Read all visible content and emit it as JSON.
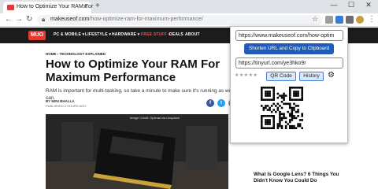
{
  "browser": {
    "tab_title": "How to Optimize Your RAM For",
    "new_tab": "+",
    "controls": {
      "minimize": "—",
      "maximize": "☐",
      "close": "✕"
    },
    "url_host": "makeuseof.com",
    "url_path": "/how-optimize-ram-for-maximum-performance/"
  },
  "site": {
    "logo": "MUO",
    "nav": [
      "PC & MOBILE ▾",
      "LIFESTYLE ▾",
      "HARDWARE ▾",
      "FREE STUFF ▾",
      "DEALS",
      "ABOUT"
    ]
  },
  "article": {
    "breadcrumb": "HOME  ›  TECHNOLOGY EXPLAINED",
    "headline": "How to Optimize Your RAM For Maximum Performance",
    "intro": "RAM is important for multi-tasking, so take a minute to make sure it's running as well as it can.",
    "byline": "BY MINI BHALLA",
    "published": "PUBLISHED 2 HOURS AGO",
    "hero_caption": "Image Credit: Optimal via Unsplash",
    "sidebar_headline": "What Is Google Lens? 6 Things You Didn't Know You Could Do"
  },
  "popup": {
    "long_url": "https://www.makeuseof.com/how-optim",
    "shorten_label": "Shorten URL and Copy to Clipboard",
    "short_url": "https://tinyurl.com/ye3hko9r",
    "stars": "★★★★★",
    "qr_label": "QR Code",
    "history_label": "History"
  }
}
